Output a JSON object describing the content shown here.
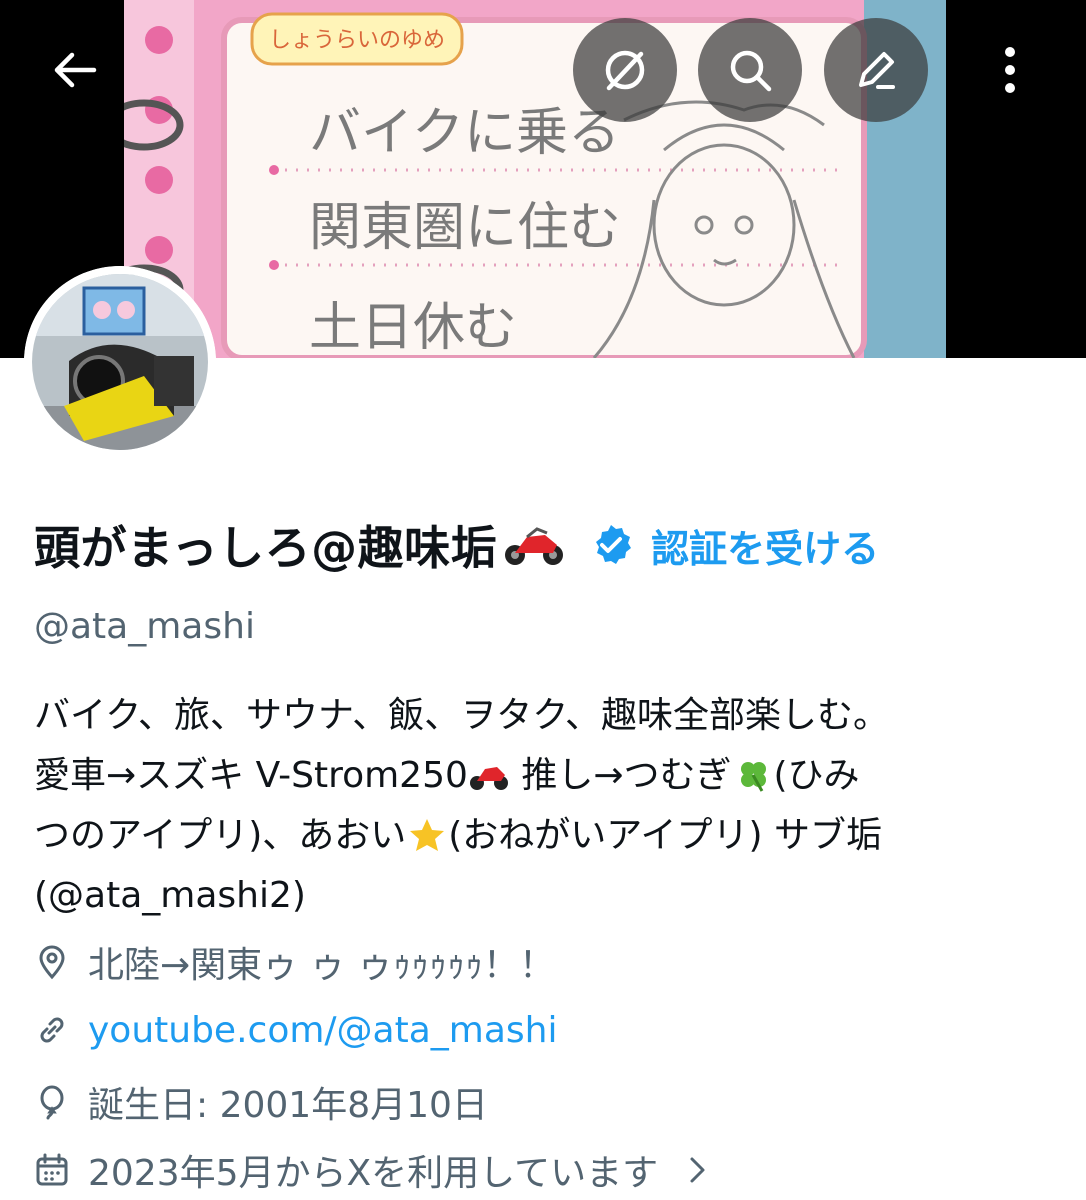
{
  "header": {
    "back_icon": "arrow-left-icon",
    "grok_icon": "grok-icon",
    "search_icon": "search-icon",
    "edit_icon": "edit-pen-icon",
    "more_icon": "more-vertical-icon"
  },
  "banner": {
    "sheet_title": "しょうらいのゆめ",
    "dream_lines": [
      "バイクに乗る",
      "関東圏に住む",
      "土日休む"
    ]
  },
  "profile": {
    "display_name": "頭がまっしろ@趣味垢",
    "name_emoji": "motorcycle-emoji",
    "verified_icon": "verified-badge-icon",
    "get_verified": "認証を受ける",
    "handle": "@ata_mashi",
    "bio": {
      "line1": "バイク、旅、サウナ、飯、ヲタク、趣味全部楽しむ。",
      "line2a": "愛車→スズキ V-Strom250",
      "line2b": " 推し→つむぎ",
      "line2c": "(ひみ",
      "line3a": "つのアイプリ)、あおい",
      "line3b": "(おねがいアイプリ) サブ垢",
      "line4": "(@ata_mashi2)"
    },
    "location": "北陸→関東ゥ ゥ ゥｩｩｩｩｩ！！",
    "website": "youtube.com/@ata_mashi",
    "birthday": "誕生日: 2001年8月10日",
    "joined": "2023年5月からXを利用しています"
  },
  "colors": {
    "accent": "#1d9bf0",
    "secondary_text": "#536471",
    "primary_text": "#0f1419",
    "banner_pink": "#f2a6c8"
  }
}
